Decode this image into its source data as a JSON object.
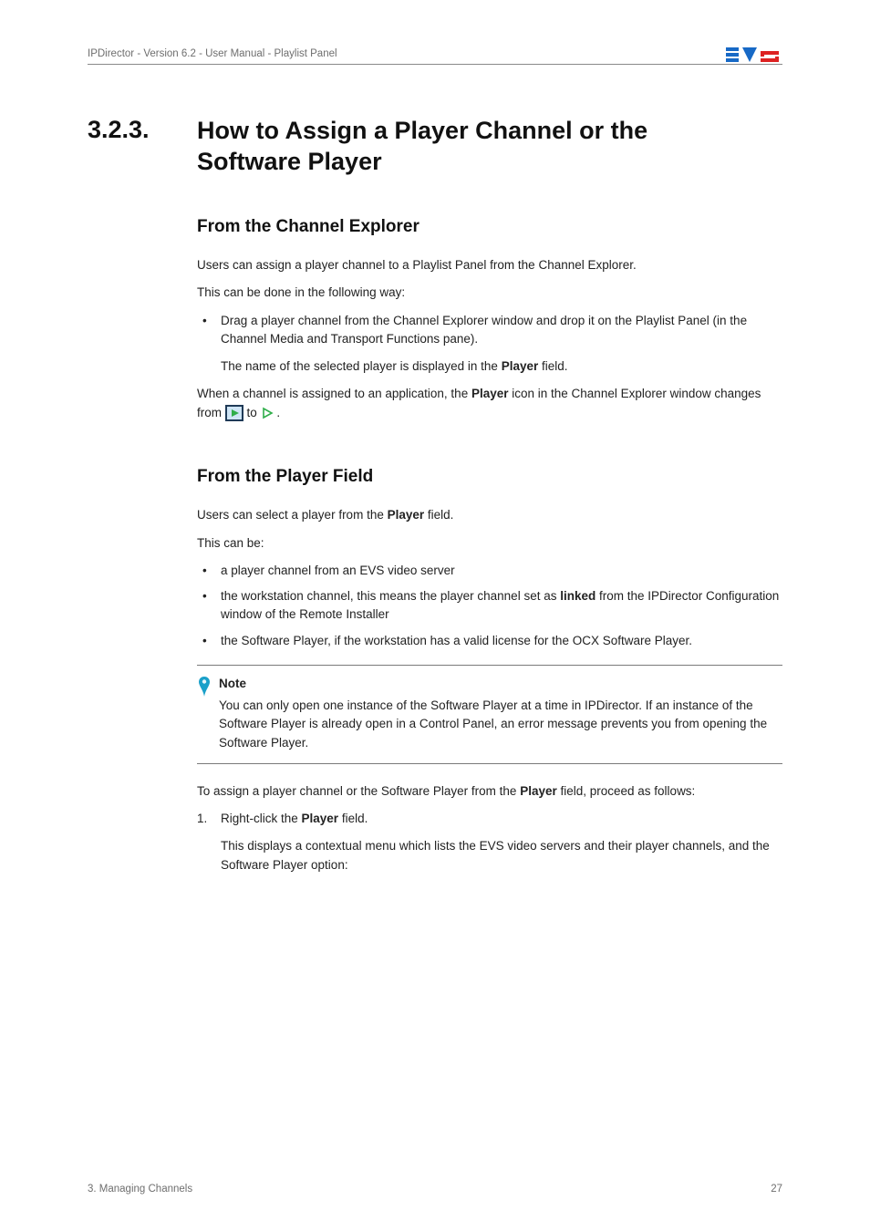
{
  "header": {
    "left": "IPDirector - Version 6.2 - User Manual - Playlist Panel"
  },
  "section": {
    "number": "3.2.3.",
    "title_line1": "How to Assign a Player Channel or the",
    "title_line2": "Software Player"
  },
  "sub1": {
    "heading": "From the Channel Explorer",
    "p1": "Users can assign a player channel to a Playlist Panel from the Channel Explorer.",
    "p2": "This can be done in the following way:",
    "bullet1": "Drag a player channel from the Channel Explorer window and drop it on the Playlist Panel (in the Channel Media and Transport Functions pane).",
    "sub_p": "The name of the selected player is displayed in the ",
    "sub_p_bold": "Player",
    "sub_p_tail": " field.",
    "p3_a": "When a channel is assigned to an application, the ",
    "p3_bold": "Player",
    "p3_b": " icon in the Channel Explorer window changes from ",
    "p3_c": " to ",
    "p3_d": " ."
  },
  "sub2": {
    "heading": "From the Player Field",
    "p1_a": "Users can select a player from the ",
    "p1_bold": "Player",
    "p1_b": " field.",
    "p2": "This can be:",
    "b1": "a player channel from an EVS video server",
    "b2_a": "the workstation channel, this means the player channel set as ",
    "b2_bold": "linked",
    "b2_b": " from the IPDirector Configuration window of the Remote Installer",
    "b3": "the Software Player, if the workstation has a valid license for the OCX Software Player.",
    "note_title": "Note",
    "note_body": "You can only open one instance of the Software Player at a time in IPDirector. If an instance of the Software Player is already open in a Control Panel, an error message prevents you from opening the Software Player.",
    "p3_a": "To assign a player channel or the Software Player from the ",
    "p3_bold": "Player",
    "p3_b": " field, proceed as follows:",
    "step1_num": "1.",
    "step1_a": "Right-click the ",
    "step1_bold": "Player",
    "step1_b": " field.",
    "step1_sub": "This displays a contextual menu which lists the EVS video servers and their player channels, and the Software Player option:"
  },
  "footer": {
    "left": "3. Managing Channels",
    "right": "27"
  },
  "icons": {
    "play_boxed": "play-boxed-icon",
    "play_tri": "play-triangle-icon",
    "note_pin": "note-pin-icon",
    "logo": "evs-logo-icon"
  }
}
